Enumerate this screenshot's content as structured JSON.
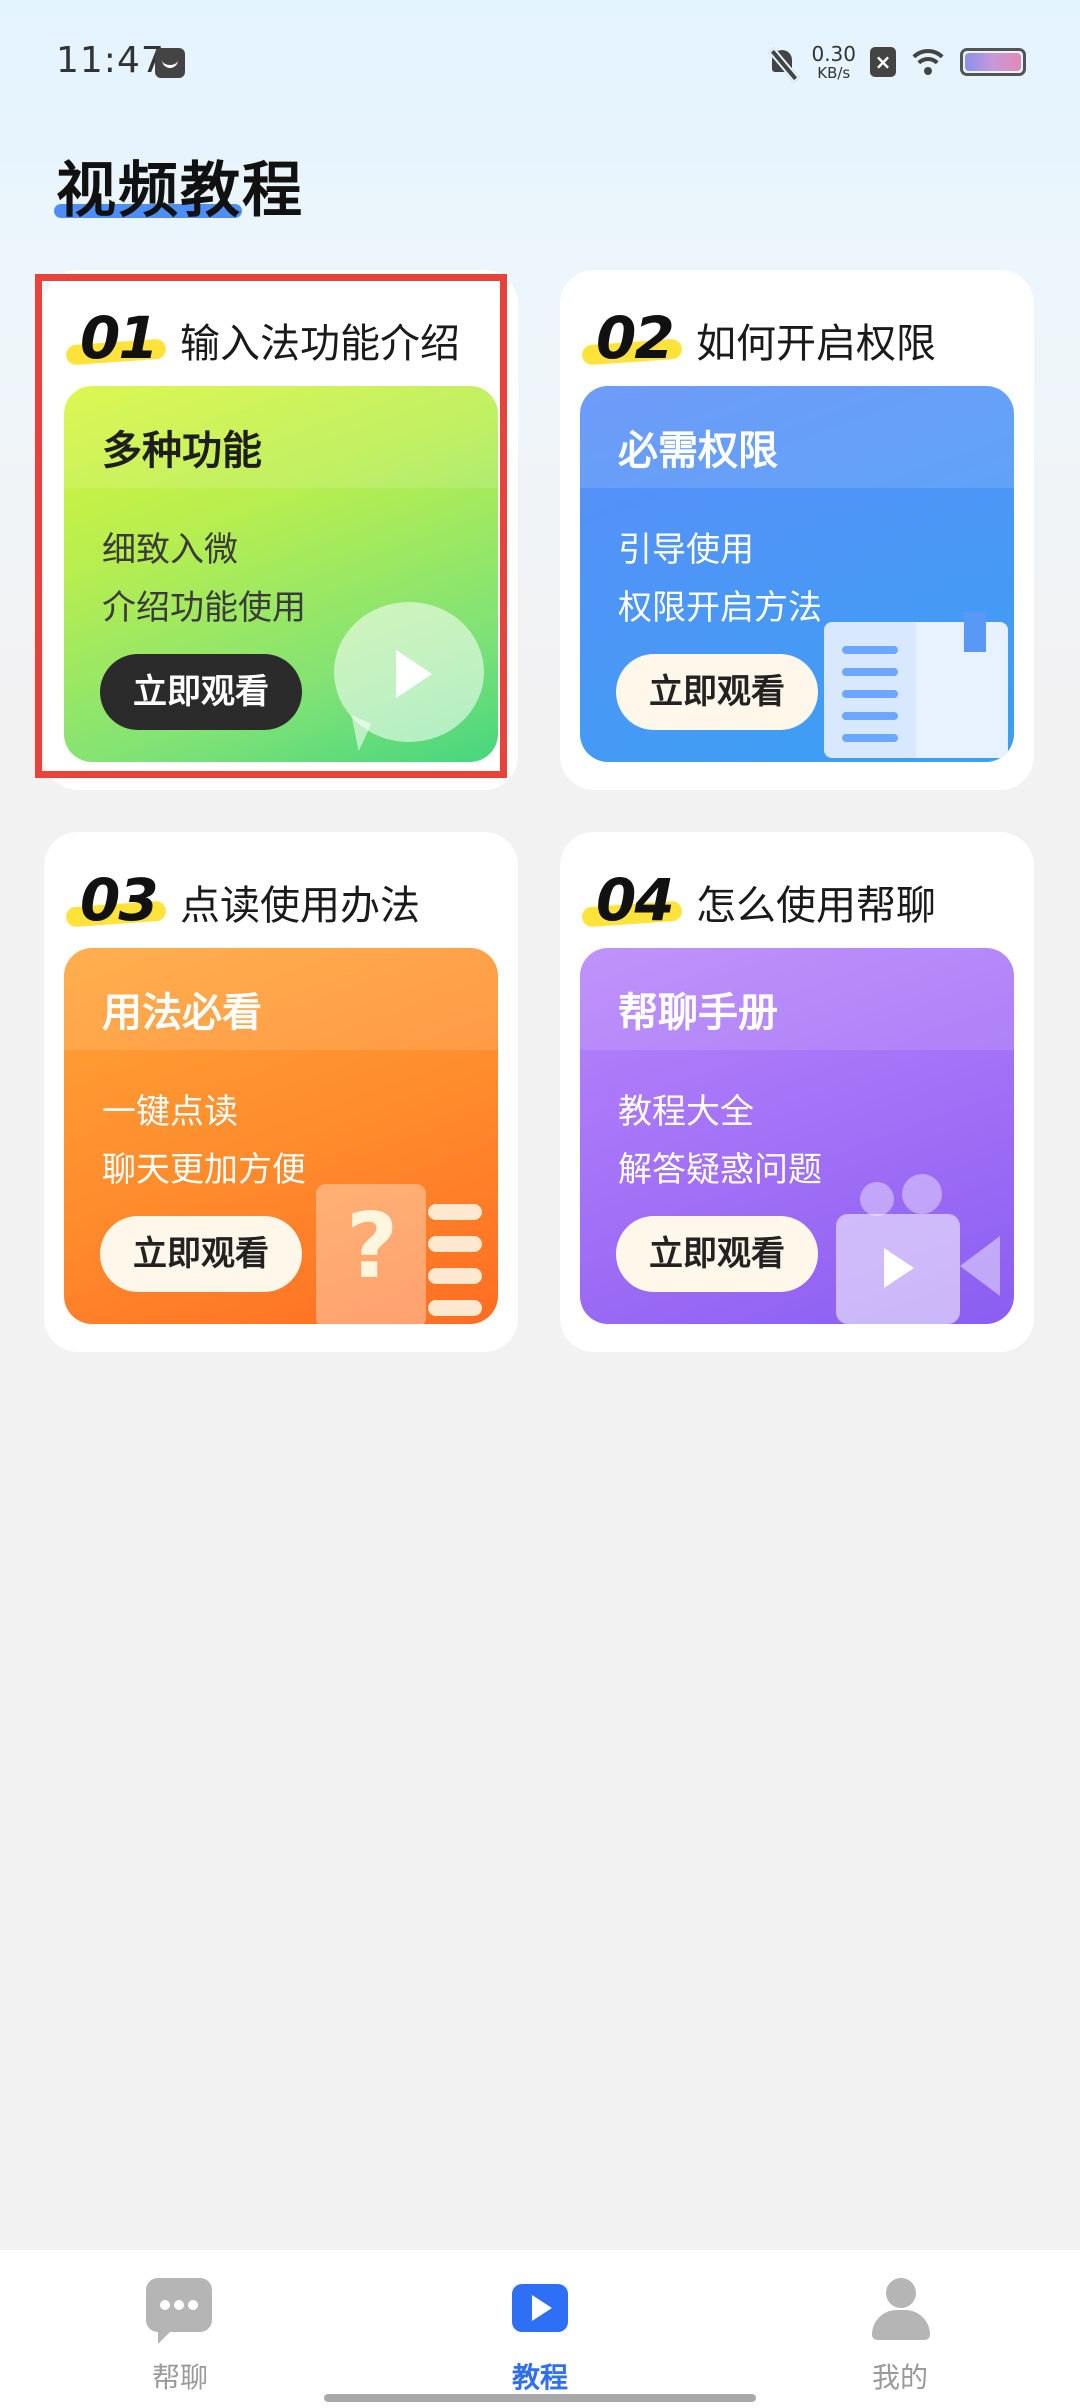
{
  "status_bar": {
    "time": "11:47",
    "net_speed": "0.30",
    "net_unit": "KB/s"
  },
  "page": {
    "title": "视频教程"
  },
  "cards": [
    {
      "number": "01",
      "title": "输入法功能介绍",
      "inner_title": "多种功能",
      "desc_line1": "细致入微",
      "desc_line2": "介绍功能使用",
      "button": "立即观看",
      "theme": "#d8f63a"
    },
    {
      "number": "02",
      "title": "如何开启权限",
      "inner_title": "必需权限",
      "desc_line1": "引导使用",
      "desc_line2": "权限开启方法",
      "button": "立即观看",
      "theme": "#4e95f7"
    },
    {
      "number": "03",
      "title": "点读使用办法",
      "inner_title": "用法必看",
      "desc_line1": "一键点读",
      "desc_line2": "聊天更加方便",
      "button": "立即观看",
      "theme": "#ff8a2c"
    },
    {
      "number": "04",
      "title": "怎么使用帮聊",
      "inner_title": "帮聊手册",
      "desc_line1": "教程大全",
      "desc_line2": "解答疑惑问题",
      "button": "立即观看",
      "theme": "#a06ff6"
    }
  ],
  "bottom_nav": {
    "items": [
      {
        "label": "帮聊",
        "icon": "chat-bubble-icon",
        "active": false
      },
      {
        "label": "教程",
        "icon": "play-icon",
        "active": true
      },
      {
        "label": "我的",
        "icon": "user-icon",
        "active": false
      }
    ],
    "active_color": "#2f6ff5"
  },
  "highlight_color": "#e9423a"
}
